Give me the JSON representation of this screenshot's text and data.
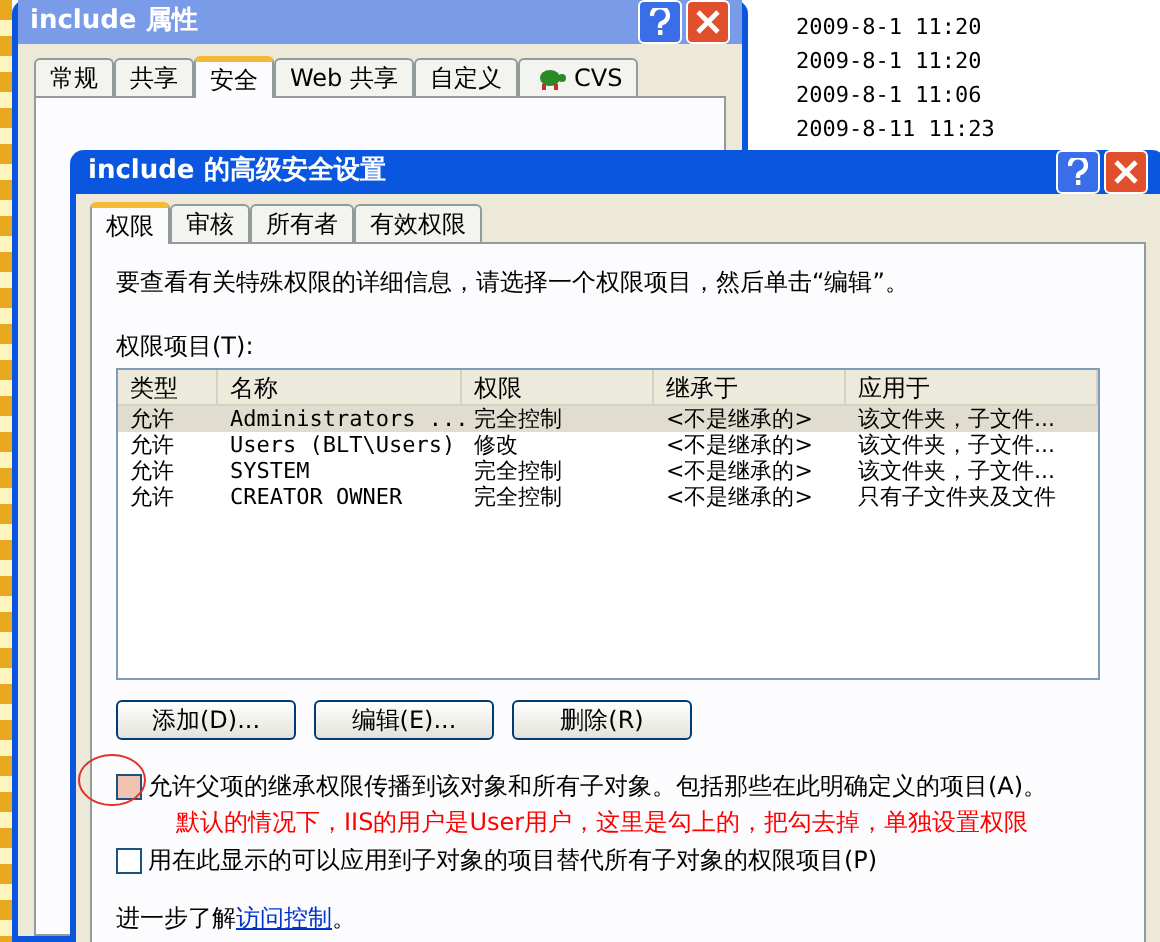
{
  "background_list": {
    "dates": [
      "2009-8-1 11:20",
      "2009-8-1 11:20",
      "2009-8-1 11:06",
      "2009-8-11 11:23"
    ]
  },
  "back_window": {
    "title": "include 属性",
    "tabs": [
      {
        "label": "常规",
        "selected": false
      },
      {
        "label": "共享",
        "selected": false
      },
      {
        "label": "安全",
        "selected": true
      },
      {
        "label": "Web 共享",
        "selected": false
      },
      {
        "label": "自定义",
        "selected": false
      },
      {
        "label": "CVS",
        "selected": false,
        "kind": "icon"
      }
    ]
  },
  "window": {
    "title": "include 的高级安全设置",
    "tabs": [
      {
        "label": "权限",
        "selected": true
      },
      {
        "label": "审核",
        "selected": false
      },
      {
        "label": "所有者",
        "selected": false
      },
      {
        "label": "有效权限",
        "selected": false
      }
    ],
    "instructions": "要查看有关特殊权限的详细信息，请选择一个权限项目，然后单击“编辑”。",
    "list_label": "权限项目(T):",
    "table": {
      "columns": [
        "类型",
        "名称",
        "权限",
        "继承于",
        "应用于"
      ],
      "rows": [
        {
          "selected": true,
          "cells": [
            "允许",
            "Administrators ...",
            "完全控制",
            "<不是继承的>",
            "该文件夹，子文件..."
          ]
        },
        {
          "selected": false,
          "cells": [
            "允许",
            "Users (BLT\\Users)",
            "修改",
            "<不是继承的>",
            "该文件夹，子文件..."
          ]
        },
        {
          "selected": false,
          "cells": [
            "允许",
            "SYSTEM",
            "完全控制",
            "<不是继承的>",
            "该文件夹，子文件..."
          ]
        },
        {
          "selected": false,
          "cells": [
            "允许",
            "CREATOR OWNER",
            "完全控制",
            "<不是继承的>",
            "只有子文件夹及文件"
          ]
        }
      ]
    },
    "buttons": [
      "添加(D)...",
      "编辑(E)...",
      "删除(R)"
    ],
    "checkboxes": [
      {
        "label": "允许父项的继承权限传播到该对象和所有子对象。包括那些在此明确定义的项目(A)。",
        "checked": false,
        "annotation": "默认的情况下，IIS的用户是User用户，这里是勾上的，把勾去掉，单独设置权限"
      },
      {
        "label": "用在此显示的可以应用到子对象的项目替代所有子对象的权限项目(P)",
        "checked": false
      }
    ],
    "footer": {
      "text": "进一步了解",
      "link": "访问控制",
      "end": "。"
    }
  }
}
